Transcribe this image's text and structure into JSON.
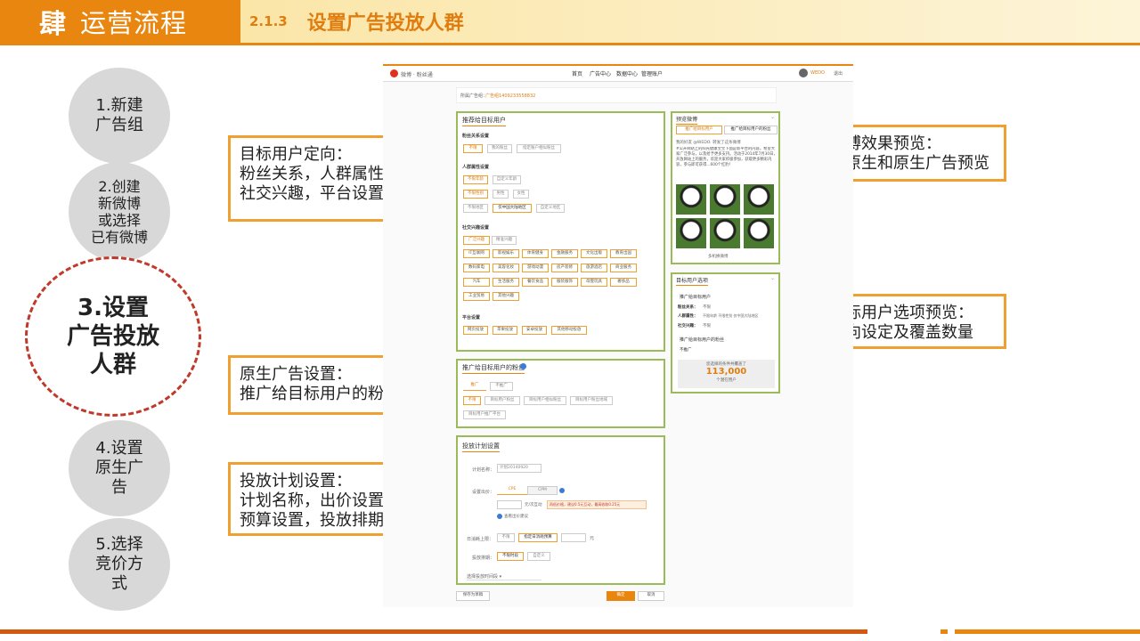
{
  "header": {
    "number": "肆",
    "title": "运营流程",
    "section_number": "2.1.3",
    "section_title": "设置广告投放人群"
  },
  "steps": [
    "1.新建\n广告组",
    "2.创建\n新微博\n或选择\n已有微博",
    "3.设置\n广告投放\n人群",
    "4.设置\n原生广\n告",
    "5.选择\n竞价方\n式"
  ],
  "callouts": {
    "targeting": "目标用户定向：\n粉丝关系，人群属性，\n社交兴趣，平台设置",
    "native": "原生广告设置：\n推广给目标用户的粉丝",
    "plan": "投放计划设置：\n计划名称，出价设置，\n预算设置，投放排期",
    "preview": "微博效果预览：\n非原生和原生广告预览",
    "options": "目标用户选项预览：\n定向设定及覆盖数量"
  },
  "colors": {
    "accent": "#e8860f",
    "panel_border": "#9bbb59",
    "step_highlight": "#c0392b",
    "callout_border": "#f0a030"
  },
  "screenshot": {
    "brand": "微博 · 粉丝通",
    "nav": [
      "首页",
      "广告中心",
      "数据中心",
      "管理账户"
    ],
    "user": "WEDO",
    "logout": "退出",
    "adgroup_label": "所属广告组：",
    "adgroup_value": "广告组1409233558832",
    "target_panel": {
      "title": "推荐给目标用户",
      "fan_title": "粉丝关系设置",
      "fan_chips": [
        "不限",
        "我的粉丝",
        "指定账户相似粉丝"
      ],
      "demo_title": "人群属性设置",
      "age_chips": [
        "不限年龄",
        "自定义年龄"
      ],
      "gender_chips": [
        "不限性别",
        "男性",
        "女性"
      ],
      "region_chips": [
        "不限地区",
        "仅中国大陆地区",
        "自定义地区"
      ],
      "social_title": "社交兴趣设置",
      "social_tabs": [
        "广泛兴趣",
        "精准兴趣"
      ],
      "interests": [
        "IT互联网",
        "影视娱乐",
        "体育健身",
        "金融服务",
        "文化出版",
        "教育出国",
        "数码家电",
        "美容化妆",
        "游戏动漫",
        "房产装修",
        "旅游酒店",
        "商业服务",
        "汽车",
        "生活服务",
        "餐饮食品",
        "服装服饰",
        "母婴玩具",
        "奢侈品",
        "工业贸易",
        "其他兴趣"
      ],
      "platform_title": "平台设置",
      "platforms": [
        "网页投放",
        "苹果投放",
        "安卓投放",
        "其他移动投放"
      ]
    },
    "fans_panel": {
      "title": "推广给目标用户的粉丝",
      "tabs": [
        "推广",
        "不推广"
      ],
      "chips": [
        "不限",
        "目标用户粉丝",
        "目标用户相似粉丝",
        "目标用户粉丝地域",
        "目标用户推广平台"
      ]
    },
    "plan_panel": {
      "title": "投放计划设置",
      "name_label": "计划名称：",
      "name_value": "计划20140920",
      "bid_label": "设置出价：",
      "bid_tabs": [
        "CPE",
        "CPM"
      ],
      "bid_unit": "元/次互动",
      "bid_hint": "再低价格，建议0.5元互动，最高收取0.25元",
      "bid_link": "查看出价建议",
      "budget_label": "日消耗上限：",
      "budget_chips": [
        "不限",
        "指定日消耗预算"
      ],
      "budget_unit": "元",
      "schedule_label": "投放排期：",
      "schedule_chips": [
        "不限时段",
        "自定义"
      ],
      "time_select": "选择投放时间段"
    },
    "save_draft": "保存为草稿",
    "submit": "确定",
    "cancel": "取消",
    "preview_panel": {
      "title": "预览微博",
      "tabs": [
        "推广给目标用户",
        "推广给目标用户的粉丝"
      ],
      "post_user": "我的好友 @WEDO: 转发了这条微博",
      "post_text": "#公开网站上的阳光健康宝宝下面是新平台的内容。希望大家广泛参与，以及给予更多支持。活动于2014年7月30日，开放网站上的服务，欢迎大家积极参加，获取更多精彩内容，参与即可获得...600个红豹！",
      "more": "多机换微博"
    },
    "options_panel": {
      "title": "目标用户选项",
      "target_label": "推广给目标用户",
      "fan_label": "粉丝关系：",
      "fan_value": "不限",
      "demo_label": "人群属性：",
      "demo_value": "不限年龄  不限性别  仅中国大陆地区",
      "social_label": "社交兴趣：",
      "social_value": "不限",
      "fans_label": "推广给目标用户的粉丝",
      "fans_value": "不推广",
      "coverage_label": "您选择的条件共覆盖了",
      "coverage_value": "113,000",
      "coverage_unit": "个潜在用户"
    }
  }
}
